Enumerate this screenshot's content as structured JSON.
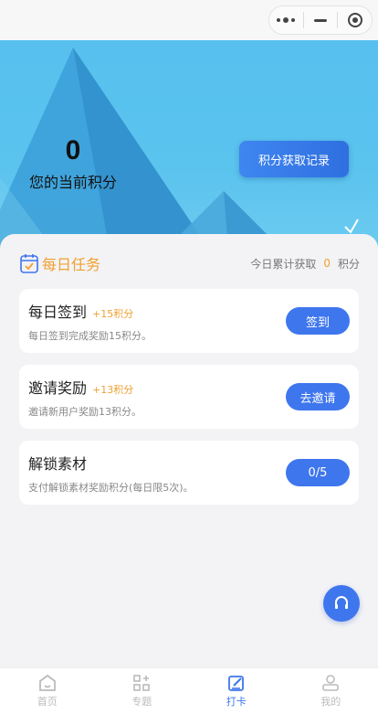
{
  "capsule": {
    "more_icon": "more-dots-icon",
    "minimize_icon": "minimize-icon",
    "close_icon": "target-close-icon"
  },
  "hero": {
    "points_value": "0",
    "points_label": "您的当前积分",
    "record_button": "积分获取记录"
  },
  "tasks_section": {
    "title": "每日任务",
    "summary_prefix": "今日累计获取",
    "summary_value": "0",
    "summary_suffix": "积分",
    "items": [
      {
        "name": "每日签到",
        "bonus": "+15积分",
        "desc": "每日签到完成奖励15积分。",
        "action": "签到"
      },
      {
        "name": "邀请奖励",
        "bonus": "+13积分",
        "desc": "邀请新用户奖励13积分。",
        "action": "去邀请"
      },
      {
        "name": "解锁素材",
        "bonus": "",
        "desc": "支付解锁素材奖励积分(每日限5次)。",
        "action": "0/5"
      }
    ]
  },
  "tabbar": {
    "items": [
      {
        "label": "首页",
        "icon": "home-icon"
      },
      {
        "label": "专题",
        "icon": "grid-icon"
      },
      {
        "label": "打卡",
        "icon": "checkin-edit-icon"
      },
      {
        "label": "我的",
        "icon": "profile-icon"
      }
    ],
    "active_index": 2
  },
  "colors": {
    "accent": "#3e76ee",
    "orange": "#f0a030"
  }
}
